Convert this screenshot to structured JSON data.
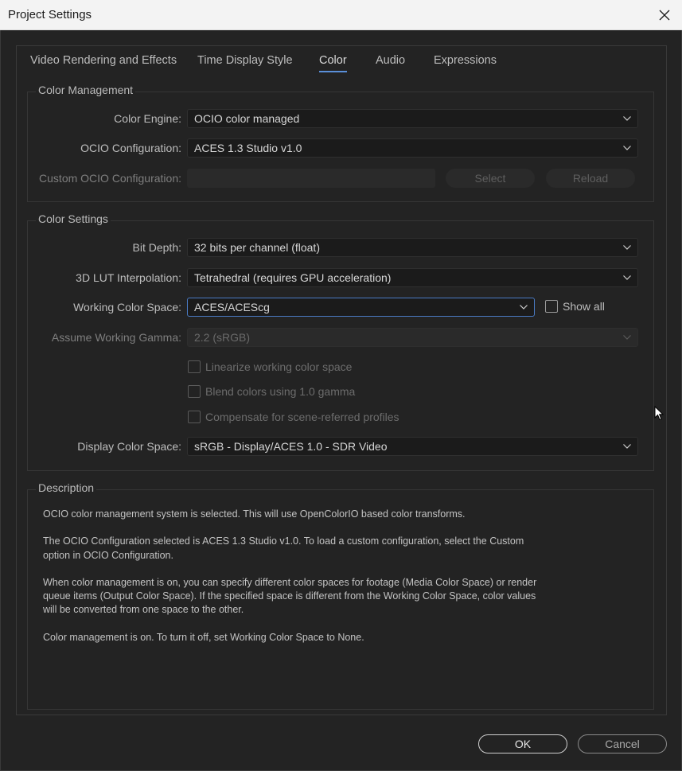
{
  "window": {
    "title": "Project Settings"
  },
  "tabs": [
    {
      "label": "Video Rendering and Effects"
    },
    {
      "label": "Time Display Style"
    },
    {
      "label": "Color"
    },
    {
      "label": "Audio"
    },
    {
      "label": "Expressions"
    }
  ],
  "active_tab": "Color",
  "color_management": {
    "title": "Color Management",
    "engine_label": "Color Engine:",
    "engine_value": "OCIO color managed",
    "ocio_config_label": "OCIO Configuration:",
    "ocio_config_value": "ACES 1.3 Studio v1.0",
    "custom_ocio_label": "Custom OCIO Configuration:",
    "custom_ocio_value": "",
    "select_label": "Select",
    "reload_label": "Reload"
  },
  "color_settings": {
    "title": "Color Settings",
    "bit_depth_label": "Bit Depth:",
    "bit_depth_value": "32 bits per channel (float)",
    "lut_label": "3D LUT Interpolation:",
    "lut_value": "Tetrahedral (requires GPU acceleration)",
    "working_space_label": "Working Color Space:",
    "working_space_value": "ACES/ACEScg",
    "show_all_label": "Show all",
    "gamma_label": "Assume Working Gamma:",
    "gamma_value": "2.2 (sRGB)",
    "linearize_label": "Linearize working color space",
    "blend_label": "Blend colors using 1.0 gamma",
    "compensate_label": "Compensate for scene-referred profiles",
    "display_space_label": "Display Color Space:",
    "display_space_value": "sRGB - Display/ACES 1.0 - SDR Video"
  },
  "description": {
    "title": "Description",
    "paragraphs": [
      "OCIO color management system is selected. This will use OpenColorIO based color transforms.",
      "The OCIO Configuration selected is ACES 1.3 Studio v1.0. To load a custom configuration, select the Custom option in OCIO Configuration.",
      "When color management is on, you can specify different color spaces for footage (Media Color Space) or render queue items (Output Color Space). If the specified space is different from the Working Color Space, color values will be converted from one space to the other.",
      "Color management is on. To turn it off, set Working Color Space to None."
    ]
  },
  "footer": {
    "ok_label": "OK",
    "cancel_label": "Cancel"
  },
  "colors": {
    "accent": "#5a8fd8",
    "background": "#232323"
  }
}
